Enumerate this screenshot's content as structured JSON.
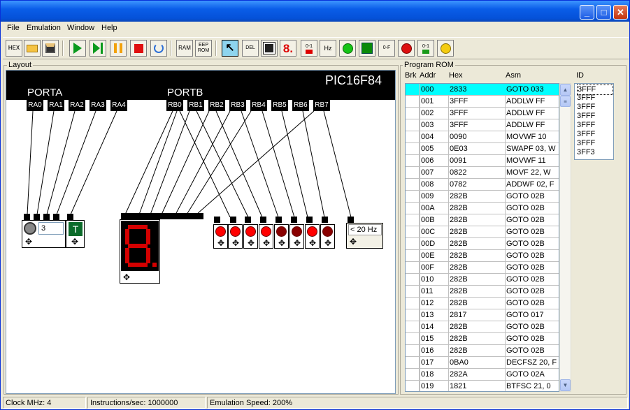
{
  "window": {
    "minimize": "_",
    "maximize": "□",
    "close": "✕"
  },
  "menu": [
    "File",
    "Emulation",
    "Window",
    "Help"
  ],
  "toolbar": {
    "hex": "HEX",
    "ram": "RAM",
    "eep": "EEP ROM",
    "del": "DEL",
    "seg": "8.",
    "bit01": "0-1",
    "hz": "Hz",
    "bit0f": "0-F"
  },
  "layout": {
    "title": "Layout",
    "chip": "PIC16F84",
    "porta_label": "PORTA",
    "portb_label": "PORTB",
    "porta_pins": [
      "RA0",
      "RA1",
      "RA2",
      "RA3",
      "RA4"
    ],
    "portb_pins": [
      "RB0",
      "RB1",
      "RB2",
      "RB3",
      "RB4",
      "RB5",
      "RB6",
      "RB7"
    ],
    "counter_value": "3",
    "freq_value": "< 20 Hz",
    "leds": [
      {
        "on": true,
        "color": "#ff0000"
      },
      {
        "on": true,
        "color": "#ff0000"
      },
      {
        "on": true,
        "color": "#ff0000"
      },
      {
        "on": true,
        "color": "#ff0000"
      },
      {
        "on": false,
        "color": "#8a0000"
      },
      {
        "on": false,
        "color": "#8a0000"
      },
      {
        "on": true,
        "color": "#ff0000"
      },
      {
        "on": false,
        "color": "#8a0000"
      }
    ]
  },
  "rom": {
    "title": "Program ROM",
    "headers": {
      "brk": "Brk",
      "addr": "Addr",
      "hex": "Hex",
      "asm": "Asm",
      "id": "ID"
    },
    "rows": [
      [
        "000",
        "2833",
        "GOTO 033"
      ],
      [
        "001",
        "3FFF",
        "ADDLW FF"
      ],
      [
        "002",
        "3FFF",
        "ADDLW FF"
      ],
      [
        "003",
        "3FFF",
        "ADDLW FF"
      ],
      [
        "004",
        "0090",
        "MOVWF 10"
      ],
      [
        "005",
        "0E03",
        "SWAPF 03, W"
      ],
      [
        "006",
        "0091",
        "MOVWF 11"
      ],
      [
        "007",
        "0822",
        "MOVF 22, W"
      ],
      [
        "008",
        "0782",
        "ADDWF 02, F"
      ],
      [
        "009",
        "282B",
        "GOTO 02B"
      ],
      [
        "00A",
        "282B",
        "GOTO 02B"
      ],
      [
        "00B",
        "282B",
        "GOTO 02B"
      ],
      [
        "00C",
        "282B",
        "GOTO 02B"
      ],
      [
        "00D",
        "282B",
        "GOTO 02B"
      ],
      [
        "00E",
        "282B",
        "GOTO 02B"
      ],
      [
        "00F",
        "282B",
        "GOTO 02B"
      ],
      [
        "010",
        "282B",
        "GOTO 02B"
      ],
      [
        "011",
        "282B",
        "GOTO 02B"
      ],
      [
        "012",
        "282B",
        "GOTO 02B"
      ],
      [
        "013",
        "2817",
        "GOTO 017"
      ],
      [
        "014",
        "282B",
        "GOTO 02B"
      ],
      [
        "015",
        "282B",
        "GOTO 02B"
      ],
      [
        "016",
        "282B",
        "GOTO 02B"
      ],
      [
        "017",
        "0BA0",
        "DECFSZ 20, F"
      ],
      [
        "018",
        "282A",
        "GOTO 02A"
      ],
      [
        "019",
        "1821",
        "BTFSC 21, 0"
      ]
    ],
    "id_values": [
      "3FFF",
      "3FFF",
      "3FFF",
      "3FFF",
      "3FFF",
      "3FFF",
      "3FFF",
      "3FF3"
    ]
  },
  "status": {
    "clock": "Clock MHz: 4",
    "ips": "Instructions/sec: 1000000",
    "speed": "Emulation Speed: 200%"
  },
  "colors": {
    "selected_row": "#00ffff",
    "led_on": "#ff0000",
    "led_off": "#8a0000",
    "seg_on": "#ff0000",
    "seg_off": "#3a0000"
  }
}
